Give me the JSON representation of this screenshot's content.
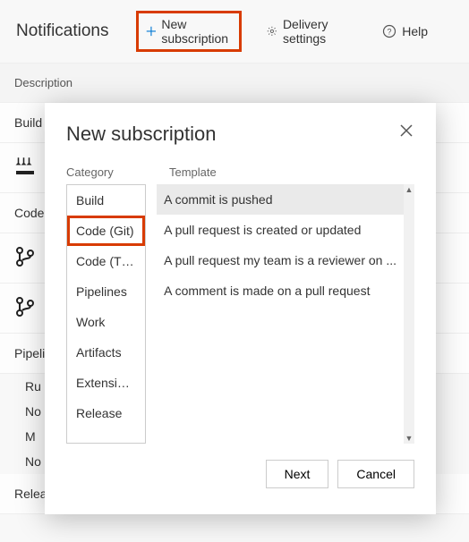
{
  "toolbar": {
    "title": "Notifications",
    "new_subscription": "New subscription",
    "delivery_settings": "Delivery settings",
    "help": "Help"
  },
  "section": {
    "description": "Description"
  },
  "groups": {
    "build": "Build",
    "code": "Code",
    "pipelines": "Pipelines",
    "release": "Release",
    "ru": "Ru",
    "no1": "No",
    "m": "M",
    "no2": "No"
  },
  "modal": {
    "title": "New subscription",
    "category_label": "Category",
    "template_label": "Template",
    "categories": [
      "Build",
      "Code (Git)",
      "Code (TFVC)",
      "Pipelines",
      "Work",
      "Artifacts",
      "Extension ...",
      "Release"
    ],
    "selected_category_index": 1,
    "templates": [
      "A commit is pushed",
      "A pull request is created or updated",
      "A pull request my team is a reviewer on ...",
      "A comment is made on a pull request"
    ],
    "selected_template_index": 0,
    "next": "Next",
    "cancel": "Cancel"
  }
}
